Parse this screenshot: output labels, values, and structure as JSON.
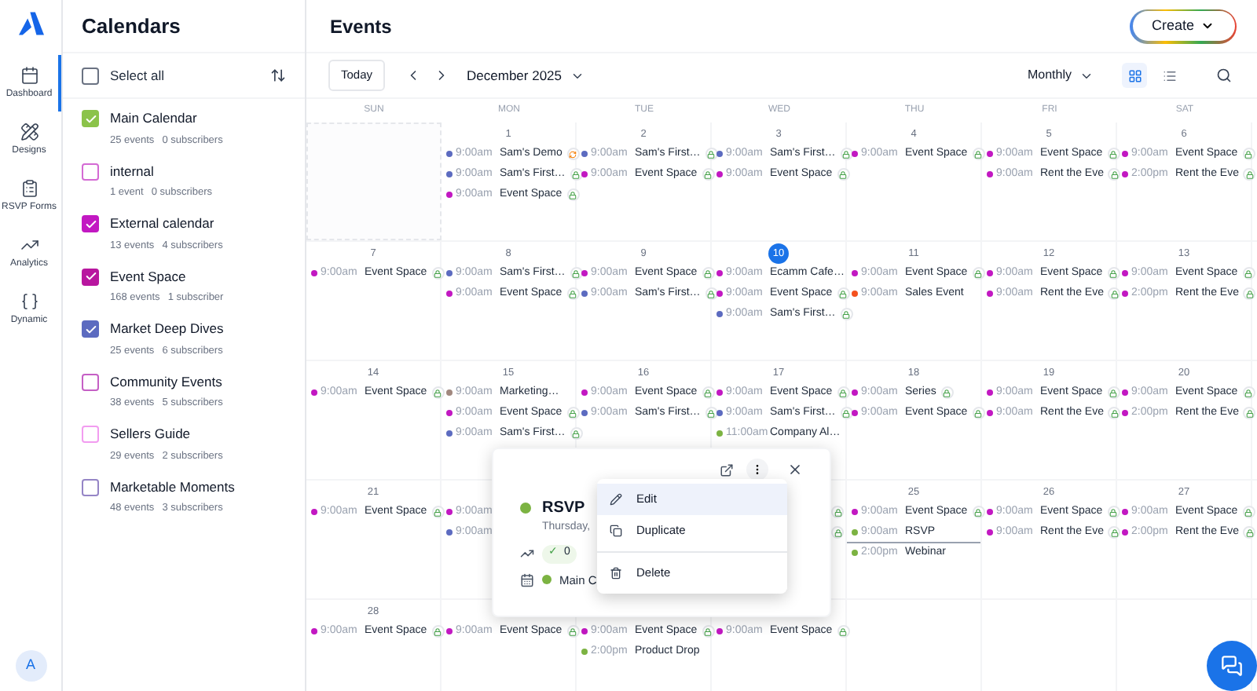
{
  "nav": {
    "items": [
      {
        "label": "Dashboard",
        "kind": "calendar",
        "selected": true
      },
      {
        "label": "Designs",
        "kind": "designs",
        "selected": false
      },
      {
        "label": "RSVP Forms",
        "kind": "form",
        "selected": false
      },
      {
        "label": "Analytics",
        "kind": "trend",
        "selected": false
      },
      {
        "label": "Dynamic",
        "kind": "braces",
        "selected": false
      }
    ],
    "avatar": "A"
  },
  "sidebar": {
    "title": "Calendars",
    "select_all": {
      "label": "Select all",
      "checked": false
    },
    "calendars": [
      {
        "name": "Main Calendar",
        "events": "25 events",
        "subscribers": "0 subscribers",
        "color": "#8bc34a",
        "checked": true
      },
      {
        "name": "internal",
        "events": "1 event",
        "subscribers": "0 subscribers",
        "color": "#d46ad4",
        "checked": false
      },
      {
        "name": "External calendar",
        "events": "13 events",
        "subscribers": "4 subscribers",
        "color": "#c218c2",
        "checked": true
      },
      {
        "name": "Event Space",
        "events": "168 events",
        "subscribers": "1 subscriber",
        "color": "#b8169f",
        "checked": true
      },
      {
        "name": "Market Deep Dives",
        "events": "25 events",
        "subscribers": "6 subscribers",
        "color": "#5c6bc0",
        "checked": true
      },
      {
        "name": "Community Events",
        "events": "38 events",
        "subscribers": "5 subscribers",
        "color": "#c55fc5",
        "checked": false
      },
      {
        "name": "Sellers Guide",
        "events": "29 events",
        "subscribers": "2 subscribers",
        "color": "#f29cf0",
        "checked": false
      },
      {
        "name": "Marketable Moments",
        "events": "48 events",
        "subscribers": "3 subscribers",
        "color": "#9585c6",
        "checked": false
      }
    ]
  },
  "header": {
    "title": "Events",
    "create": "Create"
  },
  "toolbar": {
    "today": "Today",
    "month": "December 2025",
    "view": "Monthly",
    "views": [
      {
        "kind": "grid",
        "selected": true
      },
      {
        "kind": "list",
        "selected": false
      }
    ]
  },
  "calendar": {
    "weekdays": [
      "SUN",
      "MON",
      "TUE",
      "WED",
      "THU",
      "FRI",
      "SAT"
    ],
    "weeks": [
      {
        "sun": {
          "outside": true
        },
        "mon": {
          "day": "1",
          "today": false,
          "events": [
            {
              "time": "9:00am",
              "title": "Sam's Demo",
              "color": "#5c6bc0",
              "kind": "recurring",
              "selected": false
            },
            {
              "time": "9:00am",
              "title": "Sam's First…",
              "color": "#5c6bc0",
              "kind": "locked",
              "selected": false
            },
            {
              "time": "9:00am",
              "title": "Event Space",
              "color": "#c218c2",
              "kind": "locked",
              "selected": false
            }
          ]
        },
        "tue": {
          "day": "2",
          "today": false,
          "events": [
            {
              "time": "9:00am",
              "title": "Sam's First…",
              "color": "#5c6bc0",
              "kind": "locked",
              "selected": false
            },
            {
              "time": "9:00am",
              "title": "Event Space",
              "color": "#c218c2",
              "kind": "locked",
              "selected": false
            }
          ]
        },
        "wed": {
          "day": "3",
          "today": false,
          "events": [
            {
              "time": "9:00am",
              "title": "Sam's First…",
              "color": "#5c6bc0",
              "kind": "locked",
              "selected": false
            },
            {
              "time": "9:00am",
              "title": "Event Space",
              "color": "#c218c2",
              "kind": "locked",
              "selected": false
            }
          ]
        },
        "thu": {
          "day": "4",
          "today": false,
          "events": [
            {
              "time": "9:00am",
              "title": "Event Space",
              "color": "#c218c2",
              "kind": "locked",
              "selected": false
            }
          ]
        },
        "fri": {
          "day": "5",
          "today": false,
          "events": [
            {
              "time": "9:00am",
              "title": "Event Space",
              "color": "#c218c2",
              "kind": "locked",
              "selected": false
            },
            {
              "time": "9:00am",
              "title": "Rent the Eve",
              "color": "#c218c2",
              "kind": "locked",
              "selected": false
            }
          ]
        },
        "sat": {
          "day": "6",
          "today": false,
          "events": [
            {
              "time": "9:00am",
              "title": "Event Space",
              "color": "#c218c2",
              "kind": "locked",
              "selected": false
            },
            {
              "time": "2:00pm",
              "title": "Rent the Eve",
              "color": "#c218c2",
              "kind": "locked",
              "selected": false
            }
          ]
        }
      },
      {
        "sun": {
          "day": "7",
          "today": false,
          "events": [
            {
              "time": "9:00am",
              "title": "Event Space",
              "color": "#c218c2",
              "kind": "locked",
              "selected": false
            }
          ]
        },
        "mon": {
          "day": "8",
          "today": false,
          "events": [
            {
              "time": "9:00am",
              "title": "Sam's First…",
              "color": "#5c6bc0",
              "kind": "locked",
              "selected": false
            },
            {
              "time": "9:00am",
              "title": "Event Space",
              "color": "#c218c2",
              "kind": "locked",
              "selected": false
            }
          ]
        },
        "tue": {
          "day": "9",
          "today": false,
          "events": [
            {
              "time": "9:00am",
              "title": "Event Space",
              "color": "#c218c2",
              "kind": "locked",
              "selected": false
            },
            {
              "time": "9:00am",
              "title": "Sam's First…",
              "color": "#5c6bc0",
              "kind": "locked",
              "selected": false
            }
          ]
        },
        "wed": {
          "day": "10",
          "today": true,
          "events": [
            {
              "time": "9:00am",
              "title": "Ecamm Cafe…",
              "color": "#c218c2",
              "kind": "plain",
              "selected": false
            },
            {
              "time": "9:00am",
              "title": "Event Space",
              "color": "#c218c2",
              "kind": "locked",
              "selected": false
            },
            {
              "time": "9:00am",
              "title": "Sam's First…",
              "color": "#5c6bc0",
              "kind": "locked",
              "selected": false
            }
          ]
        },
        "thu": {
          "day": "11",
          "today": false,
          "events": [
            {
              "time": "9:00am",
              "title": "Event Space",
              "color": "#c218c2",
              "kind": "locked",
              "selected": false
            },
            {
              "time": "9:00am",
              "title": "Sales Event",
              "color": "#f4511e",
              "kind": "plain",
              "selected": false
            }
          ]
        },
        "fri": {
          "day": "12",
          "today": false,
          "events": [
            {
              "time": "9:00am",
              "title": "Event Space",
              "color": "#c218c2",
              "kind": "locked",
              "selected": false
            },
            {
              "time": "9:00am",
              "title": "Rent the Eve",
              "color": "#c218c2",
              "kind": "locked",
              "selected": false
            }
          ]
        },
        "sat": {
          "day": "13",
          "today": false,
          "events": [
            {
              "time": "9:00am",
              "title": "Event Space",
              "color": "#c218c2",
              "kind": "locked",
              "selected": false
            },
            {
              "time": "2:00pm",
              "title": "Rent the Eve",
              "color": "#c218c2",
              "kind": "locked",
              "selected": false
            }
          ]
        }
      },
      {
        "sun": {
          "day": "14",
          "today": false,
          "events": [
            {
              "time": "9:00am",
              "title": "Event Space",
              "color": "#c218c2",
              "kind": "locked",
              "selected": false
            }
          ]
        },
        "mon": {
          "day": "15",
          "today": false,
          "events": [
            {
              "time": "9:00am",
              "title": "Marketing…",
              "color": "#a1887f",
              "kind": "plain",
              "selected": false
            },
            {
              "time": "9:00am",
              "title": "Event Space",
              "color": "#c218c2",
              "kind": "locked",
              "selected": false
            },
            {
              "time": "9:00am",
              "title": "Sam's First…",
              "color": "#5c6bc0",
              "kind": "locked",
              "selected": false
            }
          ]
        },
        "tue": {
          "day": "16",
          "today": false,
          "events": [
            {
              "time": "9:00am",
              "title": "Event Space",
              "color": "#c218c2",
              "kind": "locked",
              "selected": false
            },
            {
              "time": "9:00am",
              "title": "Sam's First…",
              "color": "#5c6bc0",
              "kind": "locked",
              "selected": false
            }
          ]
        },
        "wed": {
          "day": "17",
          "today": false,
          "events": [
            {
              "time": "9:00am",
              "title": "Event Space",
              "color": "#c218c2",
              "kind": "locked",
              "selected": false
            },
            {
              "time": "9:00am",
              "title": "Sam's First…",
              "color": "#5c6bc0",
              "kind": "locked",
              "selected": false
            },
            {
              "time": "11:00am",
              "title": "Company Al…",
              "color": "#7cb342",
              "kind": "plain",
              "selected": false
            }
          ]
        },
        "thu": {
          "day": "18",
          "today": false,
          "events": [
            {
              "time": "9:00am",
              "title": "Series",
              "color": "#c218c2",
              "kind": "locked",
              "selected": false
            },
            {
              "time": "9:00am",
              "title": "Event Space",
              "color": "#c218c2",
              "kind": "locked",
              "selected": false
            }
          ]
        },
        "fri": {
          "day": "19",
          "today": false,
          "events": [
            {
              "time": "9:00am",
              "title": "Event Space",
              "color": "#c218c2",
              "kind": "locked",
              "selected": false
            },
            {
              "time": "9:00am",
              "title": "Rent the Eve",
              "color": "#c218c2",
              "kind": "locked",
              "selected": false
            }
          ]
        },
        "sat": {
          "day": "20",
          "today": false,
          "events": [
            {
              "time": "9:00am",
              "title": "Event Space",
              "color": "#c218c2",
              "kind": "locked",
              "selected": false
            },
            {
              "time": "2:00pm",
              "title": "Rent the Eve",
              "color": "#c218c2",
              "kind": "locked",
              "selected": false
            }
          ]
        }
      },
      {
        "sun": {
          "day": "21",
          "today": false,
          "events": [
            {
              "time": "9:00am",
              "title": "Event Space",
              "color": "#c218c2",
              "kind": "locked",
              "selected": false
            }
          ]
        },
        "mon": {
          "events": [
            {
              "time": "9:00am",
              "color": "#c218c2",
              "kind": "plain",
              "selected": false
            },
            {
              "time": "9:00am",
              "color": "#5c6bc0",
              "kind": "plain",
              "selected": false
            }
          ]
        },
        "wed": {
          "events": [
            {
              "kind": "locked",
              "selected": false
            },
            {
              "kind": "locked",
              "selected": false
            }
          ]
        },
        "thu": {
          "day": "25",
          "today": false,
          "events": [
            {
              "time": "9:00am",
              "title": "Event Space",
              "color": "#c218c2",
              "kind": "locked",
              "selected": false
            },
            {
              "time": "9:00am",
              "title": "RSVP",
              "color": "#7cb342",
              "kind": "plain",
              "selected": true
            },
            {
              "time": "2:00pm",
              "title": "Webinar",
              "color": "#7cb342",
              "kind": "plain",
              "selected": false
            }
          ]
        },
        "fri": {
          "day": "26",
          "today": false,
          "events": [
            {
              "time": "9:00am",
              "title": "Event Space",
              "color": "#c218c2",
              "kind": "locked",
              "selected": false
            },
            {
              "time": "9:00am",
              "title": "Rent the Eve",
              "color": "#c218c2",
              "kind": "locked",
              "selected": false
            }
          ]
        },
        "sat": {
          "day": "27",
          "today": false,
          "events": [
            {
              "time": "9:00am",
              "title": "Event Space",
              "color": "#c218c2",
              "kind": "locked",
              "selected": false
            },
            {
              "time": "2:00pm",
              "title": "Rent the Eve",
              "color": "#c218c2",
              "kind": "locked",
              "selected": false
            }
          ]
        }
      },
      {
        "sun": {
          "day": "28",
          "today": false,
          "events": [
            {
              "time": "9:00am",
              "title": "Event Space",
              "color": "#c218c2",
              "kind": "locked",
              "selected": false
            }
          ]
        },
        "mon": {
          "events": [
            {
              "time": "9:00am",
              "title": "Event Space",
              "color": "#c218c2",
              "kind": "locked",
              "selected": false
            }
          ]
        },
        "tue": {
          "events": [
            {
              "time": "9:00am",
              "title": "Event Space",
              "color": "#c218c2",
              "kind": "locked",
              "selected": false
            },
            {
              "time": "2:00pm",
              "title": "Product Drop",
              "color": "#7cb342",
              "kind": "plain",
              "selected": false
            }
          ]
        },
        "wed": {
          "events": [
            {
              "time": "9:00am",
              "title": "Event Space",
              "color": "#c218c2",
              "kind": "locked",
              "selected": false
            }
          ]
        }
      }
    ]
  },
  "popup": {
    "title": "RSVP",
    "color": "#7cb342",
    "date": "Thursday,",
    "check": "✓",
    "count": "0",
    "calendar": {
      "name": "Main C",
      "color": "#7cb342"
    }
  },
  "menu": {
    "groups": [
      [
        {
          "label": "Edit",
          "kind": "edit",
          "highlighted": true
        },
        {
          "label": "Duplicate",
          "kind": "duplicate",
          "highlighted": false
        }
      ],
      [
        {
          "label": "Delete",
          "kind": "delete",
          "highlighted": false
        }
      ]
    ]
  }
}
